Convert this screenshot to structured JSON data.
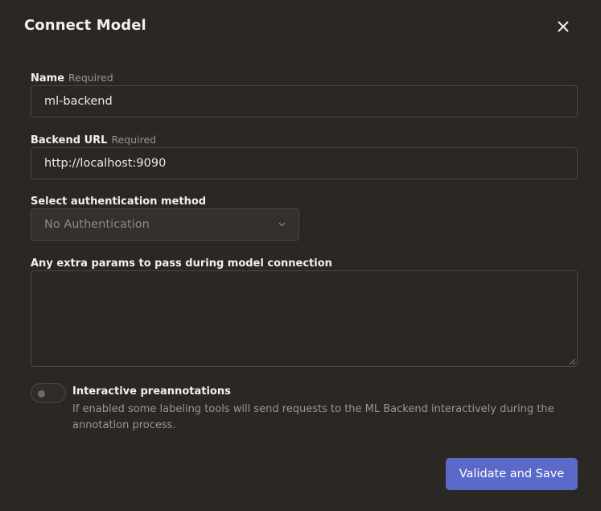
{
  "dialog": {
    "title": "Connect Model",
    "close_icon": "close-icon"
  },
  "fields": {
    "name": {
      "label": "Name",
      "required": "Required",
      "value": "ml-backend"
    },
    "backend_url": {
      "label": "Backend URL",
      "required": "Required",
      "value": "http://localhost:9090"
    },
    "auth_method": {
      "label": "Select authentication method",
      "selected": "No Authentication",
      "icon": "chevron-down-icon"
    },
    "extra_params": {
      "label": "Any extra params to pass during model connection",
      "value": ""
    }
  },
  "interactive_preannotations": {
    "title": "Interactive preannotations",
    "description": "If enabled some labeling tools will send requests to the ML Backend interactively during the annotation process.",
    "enabled": false
  },
  "actions": {
    "submit_label": "Validate and Save"
  },
  "colors": {
    "background": "#2a2725",
    "accent": "#5b6ac9",
    "border": "#4b4744",
    "muted_text": "#9b9691"
  }
}
